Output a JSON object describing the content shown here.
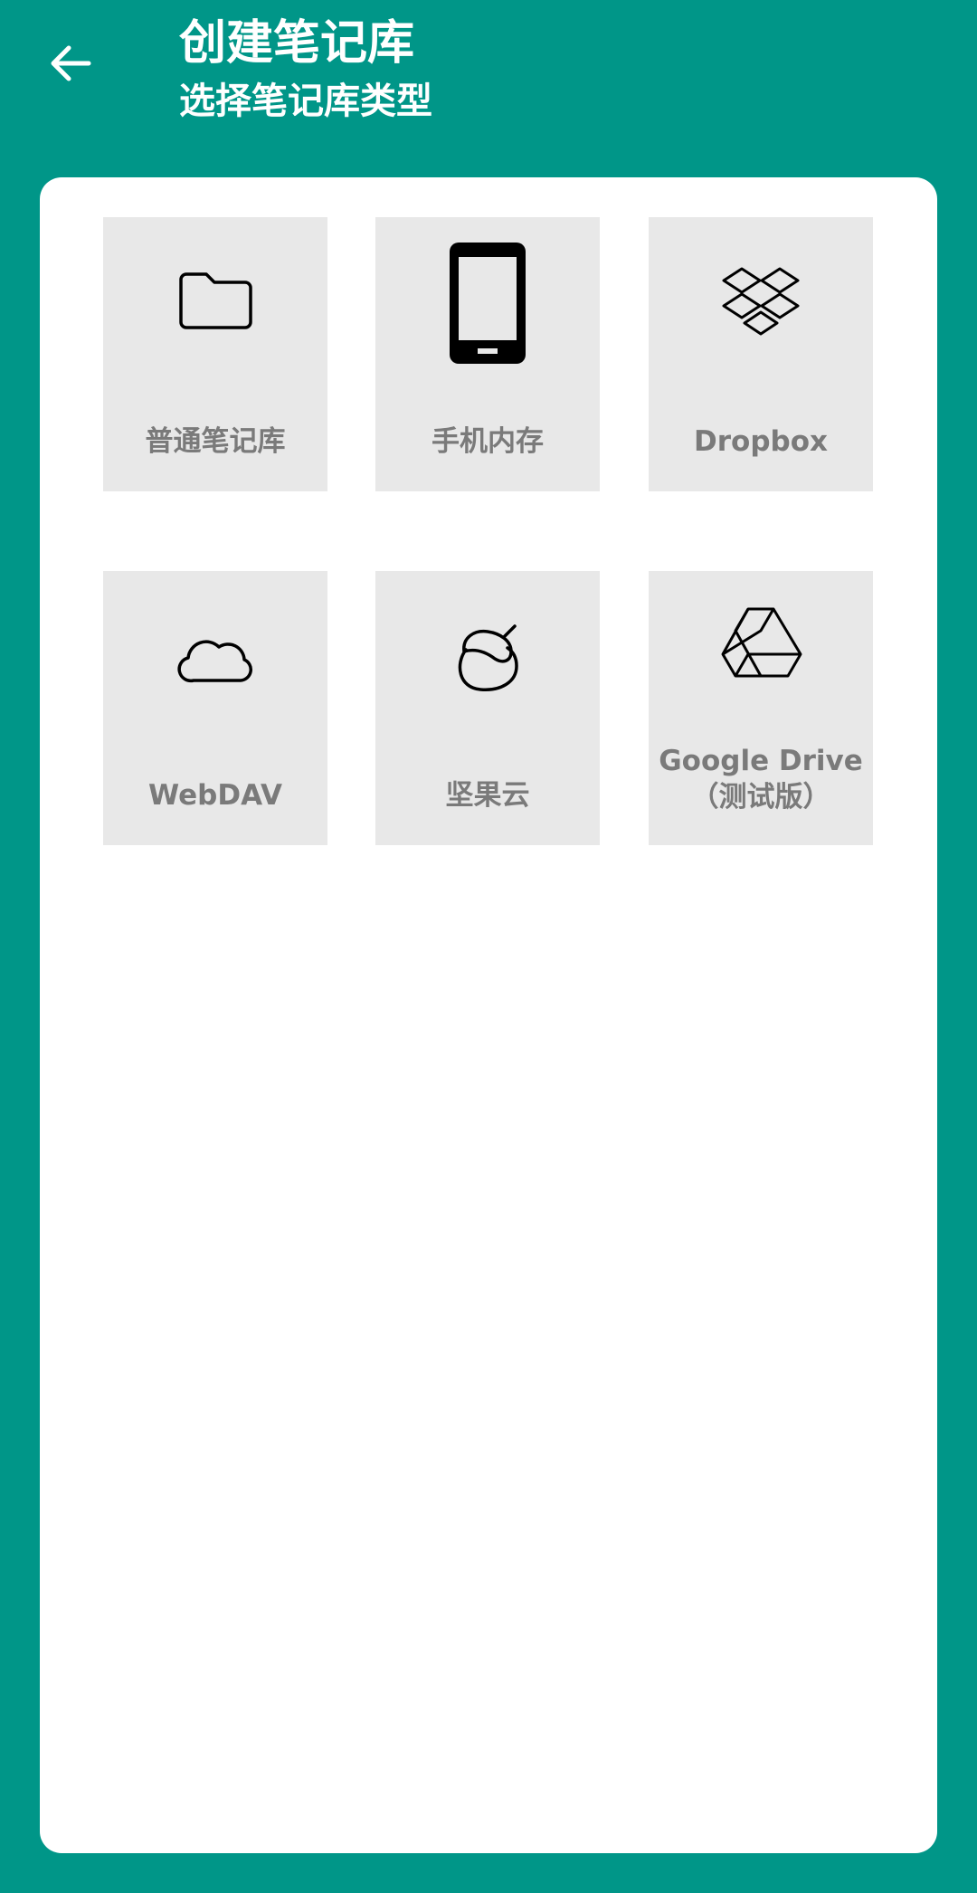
{
  "header": {
    "back_icon": "arrow-left-icon",
    "title": "创建笔记库",
    "subtitle": "选择笔记库类型"
  },
  "colors": {
    "primary": "#009688",
    "tile_bg": "#e8e8e8",
    "label": "#7a7a7a"
  },
  "options": [
    {
      "label": "普通笔记库",
      "icon": "folder-icon"
    },
    {
      "label": "手机内存",
      "icon": "smartphone-icon"
    },
    {
      "label": "Dropbox",
      "icon": "dropbox-icon"
    },
    {
      "label": "WebDAV",
      "icon": "cloud-icon"
    },
    {
      "label": "坚果云",
      "icon": "nut-icon"
    },
    {
      "label": "Google Drive",
      "label_line2": "（测试版）",
      "icon": "google-drive-icon"
    }
  ]
}
